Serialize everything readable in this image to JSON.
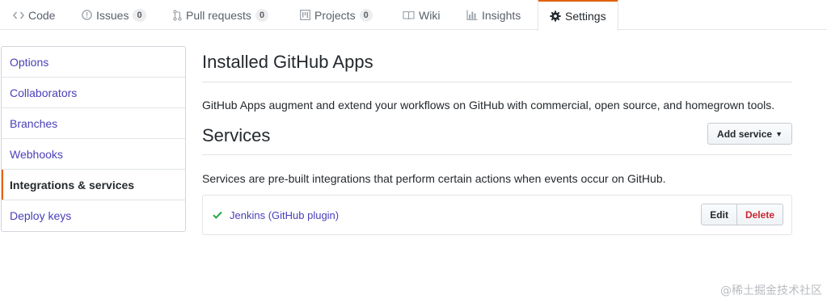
{
  "tabs": [
    {
      "id": "code",
      "label": "Code",
      "icon": "code-icon"
    },
    {
      "id": "issues",
      "label": "Issues",
      "icon": "issue-opened-icon",
      "count": "0"
    },
    {
      "id": "pulls",
      "label": "Pull requests",
      "icon": "git-pull-request-icon",
      "count": "0"
    },
    {
      "id": "projects",
      "label": "Projects",
      "icon": "project-icon",
      "count": "0"
    },
    {
      "id": "wiki",
      "label": "Wiki",
      "icon": "book-icon"
    },
    {
      "id": "insights",
      "label": "Insights",
      "icon": "graph-icon"
    },
    {
      "id": "settings",
      "label": "Settings",
      "icon": "gear-icon",
      "selected": true
    }
  ],
  "sidebar": {
    "items": [
      {
        "label": "Options"
      },
      {
        "label": "Collaborators"
      },
      {
        "label": "Branches"
      },
      {
        "label": "Webhooks"
      },
      {
        "label": "Integrations & services",
        "active": true
      },
      {
        "label": "Deploy keys"
      }
    ]
  },
  "apps": {
    "title": "Installed GitHub Apps",
    "description": "GitHub Apps augment and extend your workflows on GitHub with commercial, open source, and homegrown tools."
  },
  "services": {
    "title": "Services",
    "add_button": "Add service",
    "description": "Services are pre-built integrations that perform certain actions when events occur on GitHub.",
    "items": [
      {
        "name": "Jenkins (GitHub plugin)",
        "status_icon": "check-icon",
        "edit_label": "Edit",
        "delete_label": "Delete"
      }
    ]
  },
  "watermark": "@稀土掘金技术社区",
  "colors": {
    "accent": "#e36209",
    "link": "#4a3fb8",
    "success": "#28a745",
    "danger": "#cb2431"
  }
}
